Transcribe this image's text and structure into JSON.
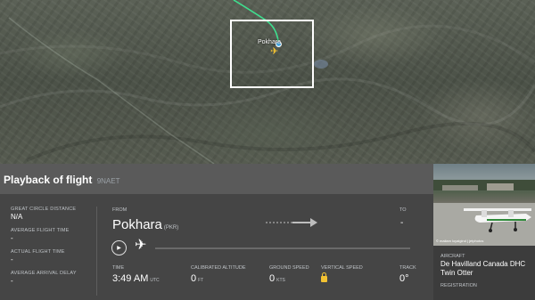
{
  "panel": {
    "title": "Playback of flight",
    "registration": "9NAET"
  },
  "stats": [
    {
      "label": "GREAT CIRCLE DISTANCE",
      "value": "N/A"
    },
    {
      "label": "AVERAGE FLIGHT TIME",
      "value": "-"
    },
    {
      "label": "ACTUAL FLIGHT TIME",
      "value": "-"
    },
    {
      "label": "AVERAGE ARRIVAL DELAY",
      "value": "-"
    }
  ],
  "route": {
    "from_label": "FROM",
    "from_city": "Pokhara",
    "from_code": "(PKR)",
    "to_label": "TO",
    "to_value": "-"
  },
  "playback": {
    "progress": 0
  },
  "live": {
    "time_label": "TIME",
    "time_value": "3:49 AM",
    "time_unit": "UTC",
    "alt_label": "CALIBRATED ALTITUDE",
    "alt_value": "0",
    "alt_unit": "FT",
    "speed_label": "GROUND SPEED",
    "speed_value": "0",
    "speed_unit": "KTS",
    "vspeed_label": "VERTICAL SPEED",
    "track_label": "TRACK",
    "track_value": "0°"
  },
  "aircraft": {
    "label": "AIRCRAFT",
    "model": "De Havilland Canada DHC Twin Otter",
    "reg_label": "REGISTRATION",
    "photo_credit": "© mailam loyalgind | jetphotos"
  },
  "colors": {
    "flight_path": "#3ee08f",
    "aircraft_marker": "#f2c232",
    "origin_marker": "#4fb3f0"
  }
}
